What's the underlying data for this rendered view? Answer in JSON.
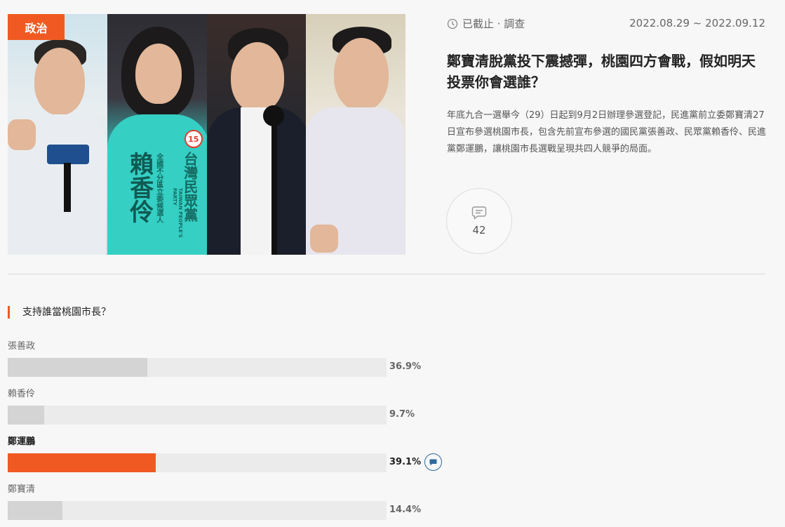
{
  "hero": {
    "category_tag": "政治",
    "portrait_text": {
      "candidate_name": "賴香伶",
      "subtitle": "全國不分區立委候選人",
      "party": "台灣民眾黨",
      "party_en": "TAIWAN PEOPLE'S PARTY",
      "number": "15"
    }
  },
  "meta": {
    "status": "已截止 · 調查",
    "status_icon": "clock-icon",
    "date_range": "2022.08.29 ~ 2022.09.12"
  },
  "article": {
    "headline": "鄭寶清脫黨投下震撼彈，桃園四方會戰，假如明天投票你會選誰？",
    "description": "年底九合一選舉今（29）日起到9月2日辦理參選登記，民進黨前立委鄭寶清27日宣布參選桃園市長，包含先前宣布參選的國民黨張善政、民眾黨賴香伶、民進黨鄭運鵬，讓桃園市長選戰呈現共四人競爭的局面。"
  },
  "comments": {
    "icon": "comment-icon",
    "count": "42"
  },
  "poll": {
    "question": "支持誰當桃園市長？",
    "accent_color": "#f05a22",
    "options": [
      {
        "label": "張善政",
        "percent_text": "36.9%",
        "percent": 36.9,
        "selected": false
      },
      {
        "label": "賴香伶",
        "percent_text": "9.7%",
        "percent": 9.7,
        "selected": false
      },
      {
        "label": "鄭運鵬",
        "percent_text": "39.1%",
        "percent": 39.1,
        "selected": true,
        "voted_icon": "vote-flag-icon"
      },
      {
        "label": "鄭寶清",
        "percent_text": "14.4%",
        "percent": 14.4,
        "selected": false
      }
    ]
  }
}
